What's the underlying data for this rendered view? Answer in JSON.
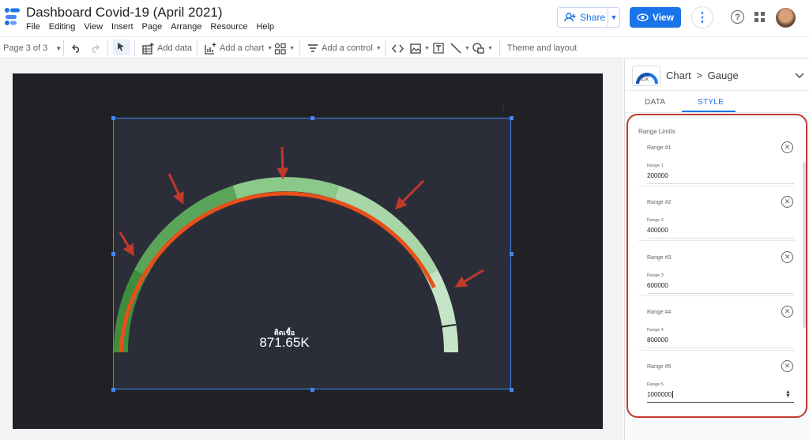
{
  "header": {
    "title": "Dashboard Covid-19 (April 2021)",
    "menu": [
      "File",
      "Editing",
      "View",
      "Insert",
      "Page",
      "Arrange",
      "Resource",
      "Help"
    ],
    "share_label": "Share",
    "view_label": "View"
  },
  "toolbar": {
    "page": "Page 3 of 3",
    "add_data": "Add data",
    "add_chart": "Add a chart",
    "add_control": "Add a control",
    "theme": "Theme and layout"
  },
  "chart": {
    "label": "ติดเชื้อ",
    "value": "871.65K"
  },
  "panel": {
    "breadcrumb_chart": "Chart",
    "breadcrumb_sep": ">",
    "breadcrumb_type": "Gauge",
    "tab_data": "DATA",
    "tab_style": "STYLE",
    "thumb_text": "111K",
    "range_limits_title": "Range Limits",
    "ranges": [
      {
        "name": "Range #1",
        "field_label": "Range 1",
        "value": "200000"
      },
      {
        "name": "Range #2",
        "field_label": "Range 2",
        "value": "400000"
      },
      {
        "name": "Range #3",
        "field_label": "Range 3",
        "value": "600000"
      },
      {
        "name": "Range #4",
        "field_label": "Range 4",
        "value": "800000"
      },
      {
        "name": "Range #5",
        "field_label": "Range 5",
        "value": "1000000"
      }
    ]
  },
  "colors": {
    "accent": "#1a73e8",
    "gauge_progress": "#e8501a",
    "annotation": "#c0392b"
  }
}
